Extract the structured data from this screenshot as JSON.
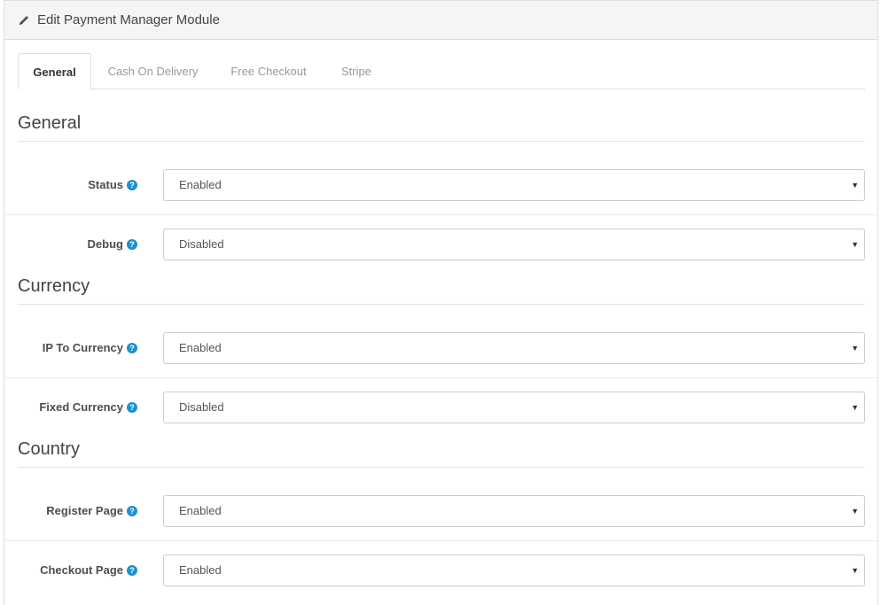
{
  "header": {
    "icon": "pencil-icon",
    "title": "Edit Payment Manager Module"
  },
  "tabs": [
    {
      "label": "General",
      "active": true
    },
    {
      "label": "Cash On Delivery",
      "active": false
    },
    {
      "label": "Free Checkout",
      "active": false
    },
    {
      "label": "Stripe",
      "active": false
    }
  ],
  "sections": {
    "general": {
      "title": "General",
      "fields": [
        {
          "label": "Status",
          "value": "Enabled"
        },
        {
          "label": "Debug",
          "value": "Disabled"
        }
      ]
    },
    "currency": {
      "title": "Currency",
      "fields": [
        {
          "label": "IP To Currency",
          "value": "Enabled"
        },
        {
          "label": "Fixed Currency",
          "value": "Disabled"
        }
      ]
    },
    "country": {
      "title": "Country",
      "fields": [
        {
          "label": "Register Page",
          "value": "Enabled"
        },
        {
          "label": "Checkout Page",
          "value": "Enabled"
        }
      ]
    }
  },
  "colors": {
    "help_icon": "#1e91cf",
    "heading_bg": "#f5f5f5",
    "border": "#dddddd"
  }
}
